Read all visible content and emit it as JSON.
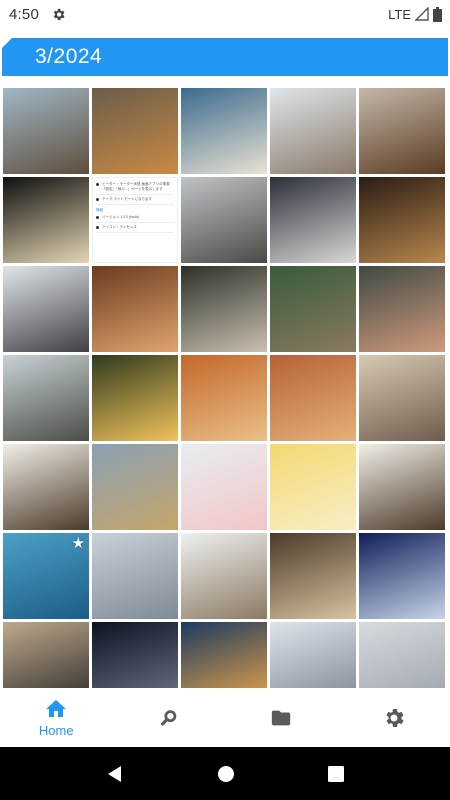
{
  "status_bar": {
    "time": "4:50",
    "network": "LTE"
  },
  "header": {
    "title": "3/2024"
  },
  "thumbnail_screenshot": {
    "rows": [
      "ヒーター・モーター状態 画面アプリの電源 「設定」「他の...」ページを表示します",
      "テーマ ライトモードになります",
      "バージョン 1.0.0 (build)",
      "アイコン・ライセンス"
    ],
    "section": "情報"
  },
  "photos": [
    {
      "c": [
        "#9fb7c5",
        "#5f4e3e"
      ],
      "star": false
    },
    {
      "c": [
        "#6b5d4a",
        "#c98a44"
      ],
      "star": false
    },
    {
      "c": [
        "#3b6a8f",
        "#e9e2d2"
      ],
      "star": false
    },
    {
      "c": [
        "#dfe5ea",
        "#8a7a6a"
      ],
      "star": false
    },
    {
      "c": [
        "#c4b8aa",
        "#5b3b22"
      ],
      "star": false
    },
    {
      "c": [
        "#0f0f0f",
        "#e4d6b3"
      ],
      "star": false
    },
    {
      "screen": true
    },
    {
      "c": [
        "#bfc4c8",
        "#4d4a45"
      ],
      "star": false
    },
    {
      "c": [
        "#2b2f38",
        "#d8d8d8"
      ],
      "star": false
    },
    {
      "c": [
        "#2a1c14",
        "#b8874d"
      ],
      "star": false
    },
    {
      "c": [
        "#dfe6ea",
        "#3f3f44"
      ],
      "star": false
    },
    {
      "c": [
        "#6b3b1e",
        "#e0a470"
      ],
      "star": false
    },
    {
      "c": [
        "#2d3026",
        "#c9c0b2"
      ],
      "star": false
    },
    {
      "c": [
        "#385b3c",
        "#8a7a60"
      ],
      "star": false
    },
    {
      "c": [
        "#3f4a44",
        "#d09a7c"
      ],
      "star": false
    },
    {
      "c": [
        "#c8d2d6",
        "#4a4d45"
      ],
      "star": false
    },
    {
      "c": [
        "#2f3a1e",
        "#f1c35b"
      ],
      "star": false
    },
    {
      "c": [
        "#c4672a",
        "#e9c087"
      ],
      "star": false
    },
    {
      "c": [
        "#b56236",
        "#e6b07a"
      ],
      "star": false
    },
    {
      "c": [
        "#d8c9b3",
        "#6e5d4c"
      ],
      "star": false
    },
    {
      "c": [
        "#f1efe6",
        "#4b3a2b"
      ],
      "star": false
    },
    {
      "c": [
        "#8aa0b4",
        "#c6a56a"
      ],
      "star": false
    },
    {
      "c": [
        "#e7edf2",
        "#f2c6c6"
      ],
      "star": false
    },
    {
      "c": [
        "#f3d872",
        "#f8eec5"
      ],
      "star": false
    },
    {
      "c": [
        "#f1efe6",
        "#4b3a2b"
      ],
      "star": false
    },
    {
      "c": [
        "#4ba0c7",
        "#1c5d86"
      ],
      "star": true
    },
    {
      "c": [
        "#c9d1d8",
        "#7e8a96"
      ],
      "star": false
    },
    {
      "c": [
        "#eef0f1",
        "#8c7a62"
      ],
      "star": false
    },
    {
      "c": [
        "#4b3a28",
        "#d8c3a0"
      ],
      "star": false
    },
    {
      "c": [
        "#0f1f5a",
        "#c7d4e8"
      ],
      "star": false
    },
    {
      "c": [
        "#bfa98a",
        "#2a2a2a"
      ],
      "star": false
    },
    {
      "c": [
        "#0c1220",
        "#6f7a8c"
      ],
      "star": false
    },
    {
      "c": [
        "#1c3a5f",
        "#f0a848"
      ],
      "star": false
    },
    {
      "c": [
        "#dfe4ea",
        "#7a8490"
      ],
      "star": false
    },
    {
      "c": [
        "#d7dbe0",
        "#9aa1a8"
      ],
      "star": false
    }
  ],
  "bottom_nav": {
    "items": [
      {
        "label": "Home",
        "icon": "home-icon",
        "active": true
      },
      {
        "label": "",
        "icon": "search-icon",
        "active": false
      },
      {
        "label": "",
        "icon": "folder-icon",
        "active": false
      },
      {
        "label": "",
        "icon": "settings-icon",
        "active": false
      }
    ]
  },
  "colors": {
    "accent": "#2196f3",
    "nav_inactive": "#5a5a5a"
  }
}
